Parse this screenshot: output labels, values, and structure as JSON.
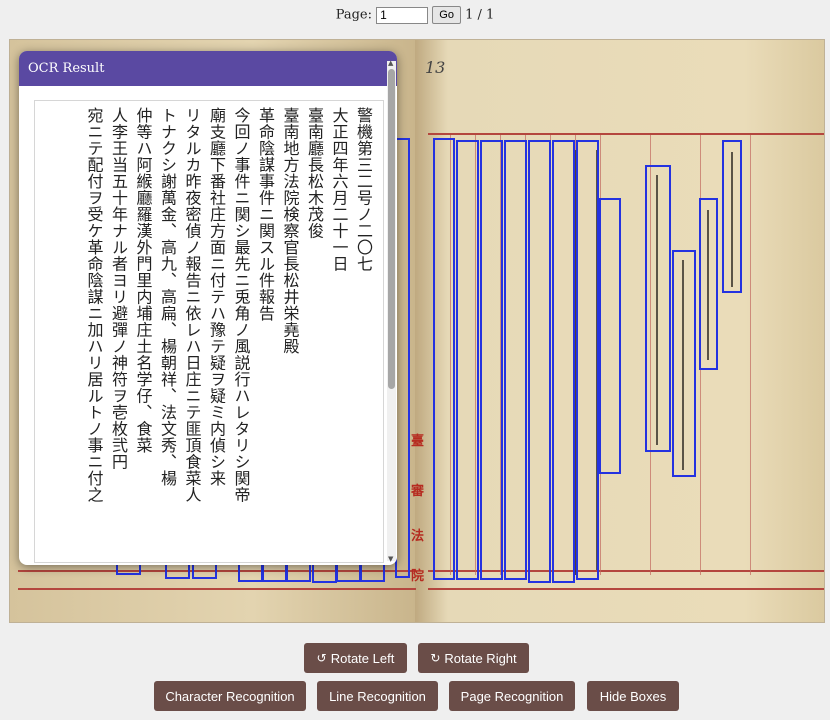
{
  "pager": {
    "label": "Page:",
    "value": "1",
    "go_label": "Go",
    "total": "1 / 1"
  },
  "ocr": {
    "title": "OCR Result",
    "lines": [
      "警機第三二号ノ二〇七",
      "大正四年六月二十一日",
      "臺南廳長松木茂俊",
      "臺南地方法院検察官長松井栄堯殿",
      "革命陰謀事件ニ関スル件報告",
      "今回ノ事件ニ関シ最先ニ兎角ノ風説行ハレタリシ関帝",
      "廟支廳下番社庄方面ニ付テハ豫テ疑ヲ疑ミ内偵シ来",
      "リタルカ昨夜密偵ノ報告ニ依レハ日庄ニテ匪頂食菜人",
      "トナクシ謝萬金、高九、高扁、楊朝祥、法文秀、楊",
      "仲等ハ阿緱廳羅漢外門里内埔庄土名学仔、食菜",
      "人李王当五十年ナル者ヨリ避彈ノ神符ヲ壱枚弐円",
      "宛ニテ配付ヲ受ケ革命陰謀ニ加ハリ居ルトノ事ニ付之"
    ]
  },
  "document": {
    "page_number": "13",
    "margin_chars": [
      "臺",
      "審",
      "法",
      "院"
    ]
  },
  "controls": {
    "rotate_left": "Rotate Left",
    "rotate_right": "Rotate Right",
    "character_recognition": "Character Recognition",
    "line_recognition": "Line Recognition",
    "page_recognition": "Page Recognition",
    "hide_boxes": "Hide Boxes"
  },
  "icons": {
    "rotate_left": "rotate-ccw-icon",
    "rotate_right": "rotate-cw-icon"
  },
  "colors": {
    "panel_header": "#5a49a2",
    "button": "#6a4d48",
    "box": "#2432e0"
  }
}
